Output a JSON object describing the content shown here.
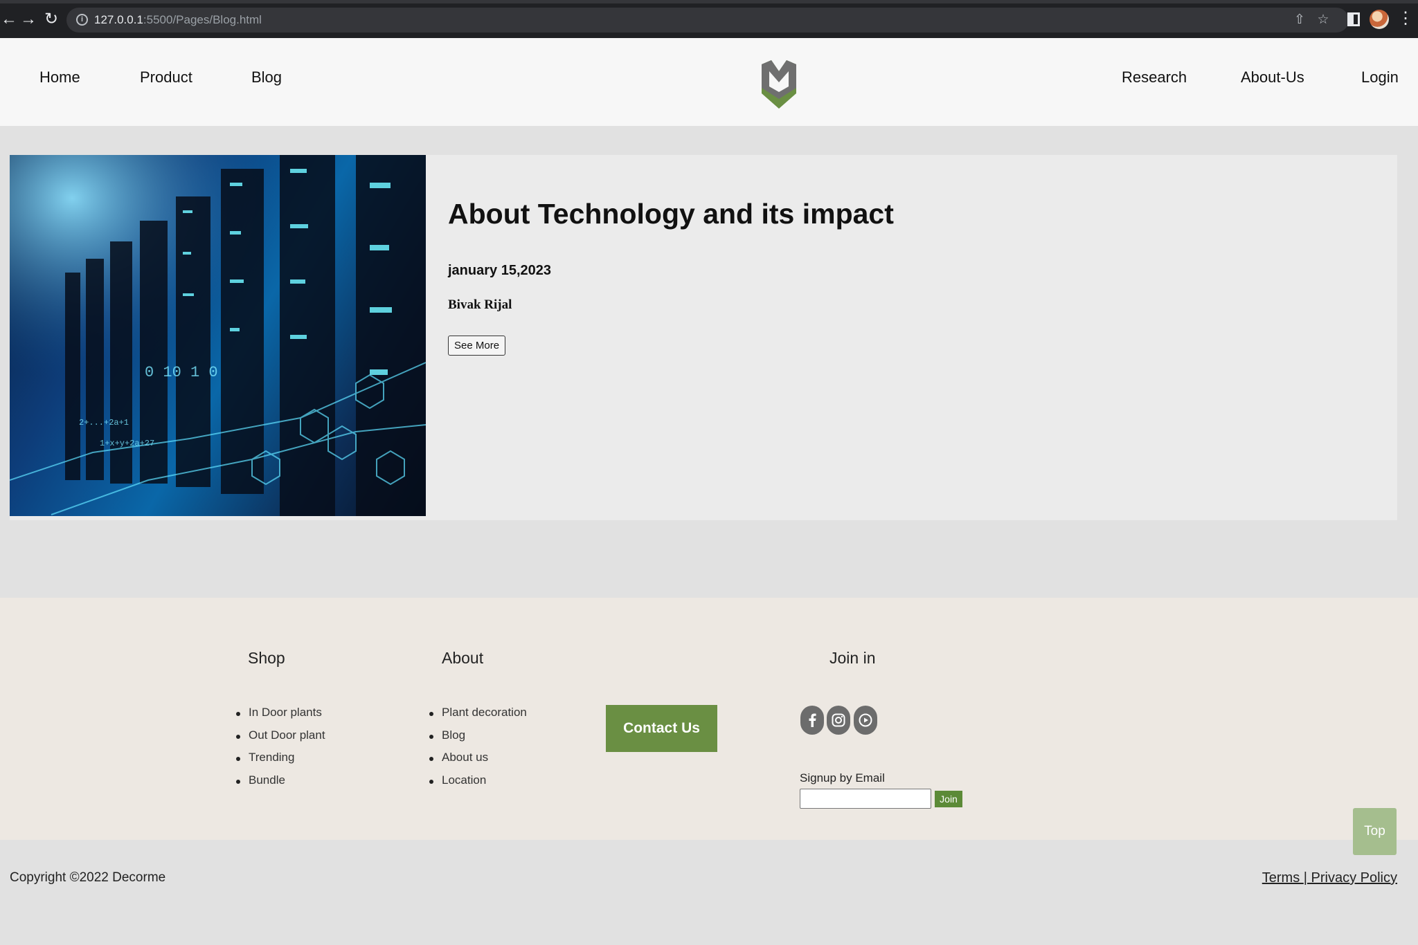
{
  "browser": {
    "url_host": "127.0.0.1",
    "url_rest": ":5500/Pages/Blog.html"
  },
  "nav": {
    "left": [
      "Home",
      "Product",
      "Blog"
    ],
    "right": [
      "Research",
      "About-Us",
      "Login"
    ]
  },
  "post": {
    "title": "About Technology and its impact",
    "date": "january 15,2023",
    "author": "Bivak Rijal",
    "see_more": "See More"
  },
  "footer": {
    "shop": {
      "heading": "Shop",
      "items": [
        "In Door plants",
        "Out Door plant",
        "Trending",
        "Bundle"
      ]
    },
    "about": {
      "heading": "About",
      "items": [
        "Plant decoration",
        "Blog",
        "About us",
        "Location"
      ]
    },
    "contact_label": "Contact Us",
    "join": {
      "heading": "Join in",
      "signup_label": "Signup by Email",
      "join_label": "Join"
    },
    "top_label": "Top",
    "copyright": "Copyright ©2022 Decorme",
    "terms": "Terms ",
    "separator": "|",
    "privacy": " Privacy Policy"
  },
  "colors": {
    "brand_green": "#6a8f43",
    "logo_gray": "#6f6f6f"
  },
  "icons": [
    "back-icon",
    "forward-icon",
    "reload-icon",
    "share-icon",
    "star-icon",
    "facebook-icon",
    "instagram-icon",
    "youtube-icon"
  ]
}
